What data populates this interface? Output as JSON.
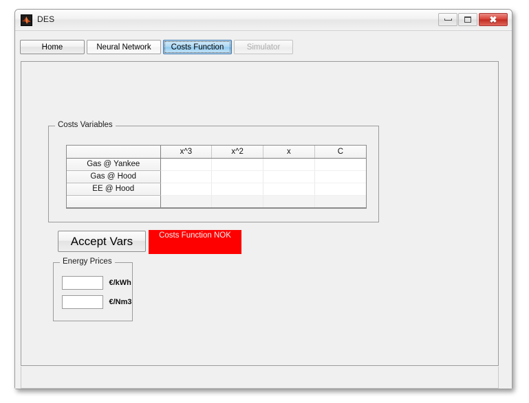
{
  "window": {
    "title": "DES",
    "icon": "matlab-logo-icon",
    "controls": {
      "minimize": "minimize-icon",
      "maximize": "maximize-icon",
      "close": "close-icon"
    }
  },
  "tabs": [
    {
      "label": "Home",
      "state": "normal"
    },
    {
      "label": "Neural Network",
      "state": "normal"
    },
    {
      "label": "Costs Function",
      "state": "selected"
    },
    {
      "label": "Simulator",
      "state": "disabled"
    }
  ],
  "costs_variables": {
    "title": "Costs Variables",
    "table": {
      "corner_header": "",
      "columns": [
        "x^3",
        "x^2",
        "x",
        "C"
      ],
      "rows": [
        {
          "header": "Gas @ Yankee",
          "values": [
            "",
            "",
            "",
            ""
          ]
        },
        {
          "header": "Gas @ Hood",
          "values": [
            "",
            "",
            "",
            ""
          ]
        },
        {
          "header": "EE @ Hood",
          "values": [
            "",
            "",
            "",
            ""
          ]
        },
        {
          "header": "",
          "values": [
            "",
            "",
            "",
            ""
          ]
        }
      ]
    }
  },
  "actions": {
    "accept_vars_label": "Accept Vars",
    "status_label": "Costs Function NOK",
    "status_color": "#ff0000",
    "status_text_color": "#f2f2f2"
  },
  "energy_prices": {
    "title": "Energy Prices",
    "fields": [
      {
        "value": "",
        "placeholder": "",
        "unit": "€/kWh"
      },
      {
        "value": "",
        "placeholder": "",
        "unit": "€/Nm3"
      }
    ]
  }
}
